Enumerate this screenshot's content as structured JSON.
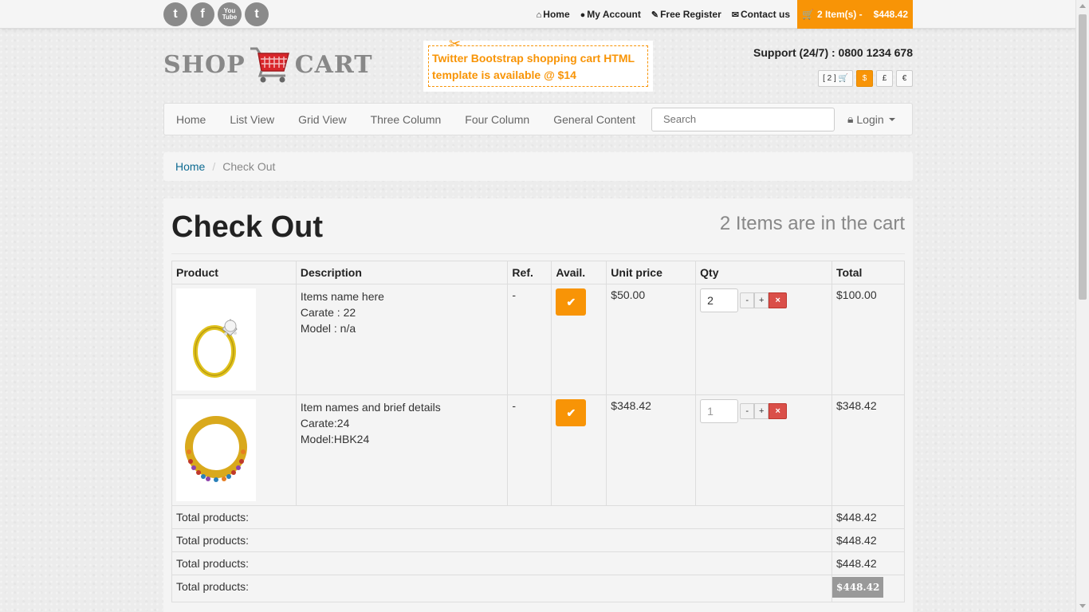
{
  "social": [
    "t",
    "f",
    "You Tube",
    "t"
  ],
  "toplinks": {
    "home": "Home",
    "account": "My Account",
    "register": "Free Register",
    "contact": "Contact us"
  },
  "cart_button": {
    "items": "2 Item(s) -",
    "price": "$448.42"
  },
  "logo": {
    "left": "SHOP",
    "right": "CART"
  },
  "promo": {
    "text": "Twitter Bootstrap shopping cart HTML template is available @ $14"
  },
  "support": "Support (24/7) : 0800 1234 678",
  "currency": {
    "cart": "[ 2 ]",
    "usd": "$",
    "gbp": "£",
    "eur": "€"
  },
  "nav": {
    "items": [
      "Home",
      "List View",
      "Grid View",
      "Three Column",
      "Four Column",
      "General Content"
    ],
    "search_placeholder": "Search",
    "login": "Login"
  },
  "breadcrumb": {
    "home": "Home",
    "current": "Check Out"
  },
  "page": {
    "title": "Check Out",
    "count": "2 Items are in the cart"
  },
  "table": {
    "headers": [
      "Product",
      "Description",
      "Ref.",
      "Avail.",
      "Unit price",
      "Qty",
      "Total"
    ],
    "rows": [
      {
        "desc": [
          "Items name here",
          "Carate : 22",
          "Model : n/a"
        ],
        "ref": "-",
        "unit": "$50.00",
        "qty": "2",
        "total": "$100.00"
      },
      {
        "desc": [
          "Item names and brief details",
          "Carate:24",
          "Model:HBK24"
        ],
        "ref": "-",
        "unit": "$348.42",
        "qty": "1",
        "total": "$348.42"
      }
    ],
    "totals": [
      {
        "label": "Total products:",
        "value": "$448.42"
      },
      {
        "label": "Total products:",
        "value": "$448.42"
      },
      {
        "label": "Total products:",
        "value": "$448.42"
      },
      {
        "label": "Total products:",
        "value": "$448.42"
      }
    ],
    "minus": "-",
    "plus": "+",
    "remove": "×"
  },
  "colors": {
    "accent": "#f89406",
    "danger": "#da4f49",
    "link": "#0e6b92"
  }
}
